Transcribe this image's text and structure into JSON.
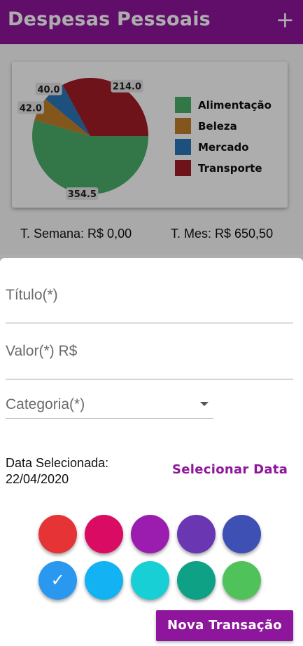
{
  "appbar": {
    "title": "Despesas Pessoais",
    "add_icon": "+"
  },
  "chart_data": {
    "type": "pie",
    "categories": [
      "Alimentação",
      "Beleza",
      "Mercado",
      "Transporte"
    ],
    "values": [
      354.5,
      42.0,
      40.0,
      214.0
    ],
    "value_labels": [
      "354.5",
      "42.0",
      "40.0",
      "214.0"
    ],
    "colors": [
      "#4caf6b",
      "#c17f2a",
      "#2b77b7",
      "#a11c26"
    ],
    "legend_position": "right"
  },
  "totals": {
    "week": "T. Semana: R$ 0,00",
    "month": "T. Mes: R$ 650,50"
  },
  "form": {
    "title_placeholder": "Título(*)",
    "value_placeholder": "Valor(*) R$",
    "category_placeholder": "Categoria(*)",
    "date_label": "Data Selecionada:",
    "date_value": "22/04/2020",
    "select_date": "Selecionar Data",
    "submit": "Nova Transação"
  },
  "colors": {
    "accent": "#8e169c",
    "palette": [
      "#e63336",
      "#d90b62",
      "#9b1daf",
      "#6a36b2",
      "#3f50b5",
      "#2b98ef",
      "#13b2f2",
      "#17cfd4",
      "#0ea185",
      "#4fc25a"
    ],
    "selected_index": 5
  },
  "icons": {
    "add": "plus-icon",
    "dropdown": "chevron-down-icon",
    "check": "check-icon"
  }
}
